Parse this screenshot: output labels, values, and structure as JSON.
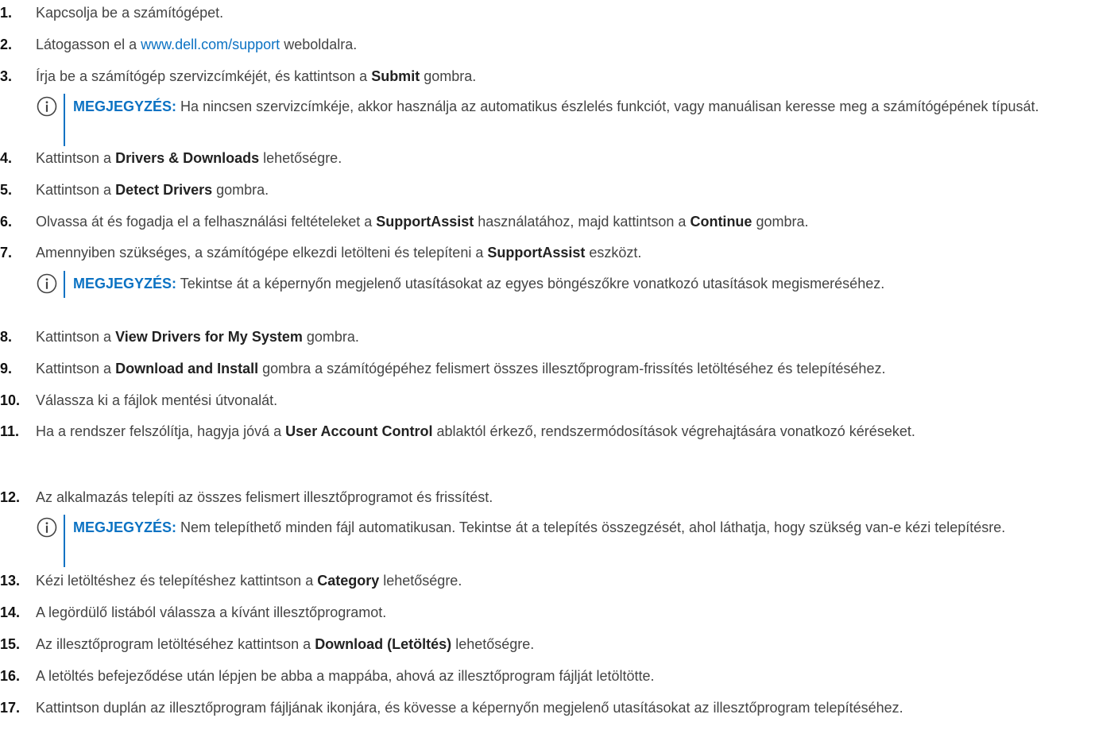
{
  "steps": [
    {
      "num": "1.",
      "parts": [
        "Kapcsolja be a számítógépet."
      ]
    },
    {
      "num": "2.",
      "parts": [
        "Látogasson el a ",
        "www.dell.com/support",
        " weboldalra."
      ]
    },
    {
      "num": "3.",
      "parts": [
        "Írja be a számítógép szervizcímkéjét, és kattintson a ",
        "Submit",
        " gombra."
      ]
    },
    {
      "num": "4.",
      "parts": [
        "Kattintson a ",
        "Drivers & Downloads",
        " lehetőségre."
      ]
    },
    {
      "num": "5.",
      "parts": [
        "Kattintson a ",
        "Detect Drivers",
        " gombra."
      ]
    },
    {
      "num": "6.",
      "parts": [
        "Olvassa át és fogadja el a felhasználási feltételeket a ",
        "SupportAssist",
        " használatához, majd kattintson a ",
        "Continue",
        " gombra."
      ]
    },
    {
      "num": "7.",
      "parts": [
        "Amennyiben szükséges, a számítógépe elkezdi letölteni és telepíteni a ",
        "SupportAssist",
        " eszközt."
      ]
    },
    {
      "num": "8.",
      "parts": [
        "Kattintson a ",
        "View Drivers for My System",
        " gombra."
      ]
    },
    {
      "num": "9.",
      "parts": [
        "Kattintson a ",
        "Download and Install",
        " gombra a számítógépéhez felismert összes illesztőprogram-frissítés letöltéséhez és telepítéséhez."
      ]
    },
    {
      "num": "10.",
      "parts": [
        "Válassza ki a fájlok mentési útvonalát."
      ]
    },
    {
      "num": "11.",
      "parts": [
        "Ha a rendszer felszólítja, hagyja jóvá a ",
        "User Account Control",
        " ablaktól érkező, rendszermódosítások végrehajtására vonatkozó kéréseket."
      ]
    },
    {
      "num": "12.",
      "parts": [
        "Az alkalmazás telepíti az összes felismert illesztőprogramot és frissítést."
      ]
    },
    {
      "num": "13.",
      "parts": [
        "Kézi letöltéshez és telepítéshez kattintson a ",
        "Category",
        " lehetőségre."
      ]
    },
    {
      "num": "14.",
      "parts": [
        "A legördülő listából válassza a kívánt illesztőprogramot."
      ]
    },
    {
      "num": "15.",
      "parts": [
        "Az illesztőprogram letöltéséhez kattintson a ",
        "Download (Letöltés)",
        " lehetőségre."
      ]
    },
    {
      "num": "16.",
      "parts": [
        "A letöltés befejeződése után lépjen be abba a mappába, ahová az illesztőprogram fájlját letöltötte."
      ]
    },
    {
      "num": "17.",
      "parts": [
        "Kattintson duplán az illesztőprogram fájljának ikonjára, és kövesse a képernyőn megjelenő utasításokat az illesztőprogram telepítéséhez."
      ]
    }
  ],
  "notes": [
    {
      "label": "MEGJEGYZÉS:",
      "text": " Ha nincsen szervizcímkéje, akkor használja az automatikus észlelés funkciót, vagy manuálisan keresse meg a számítógépének típusát."
    },
    {
      "label": "MEGJEGYZÉS:",
      "text": " Tekintse át a képernyőn megjelenő utasításokat az egyes böngészőkre vonatkozó utasítások megismeréséhez."
    },
    {
      "label": "MEGJEGYZÉS:",
      "text": " Nem telepíthető minden fájl automatikusan. Tekintse át a telepítés összegzését, ahol láthatja, hogy szükség van-e kézi telepítésre."
    }
  ],
  "colors": {
    "accent": "#0b72c3",
    "text": "#444444",
    "number": "#111111"
  },
  "icons": {
    "note": "info-icon"
  }
}
